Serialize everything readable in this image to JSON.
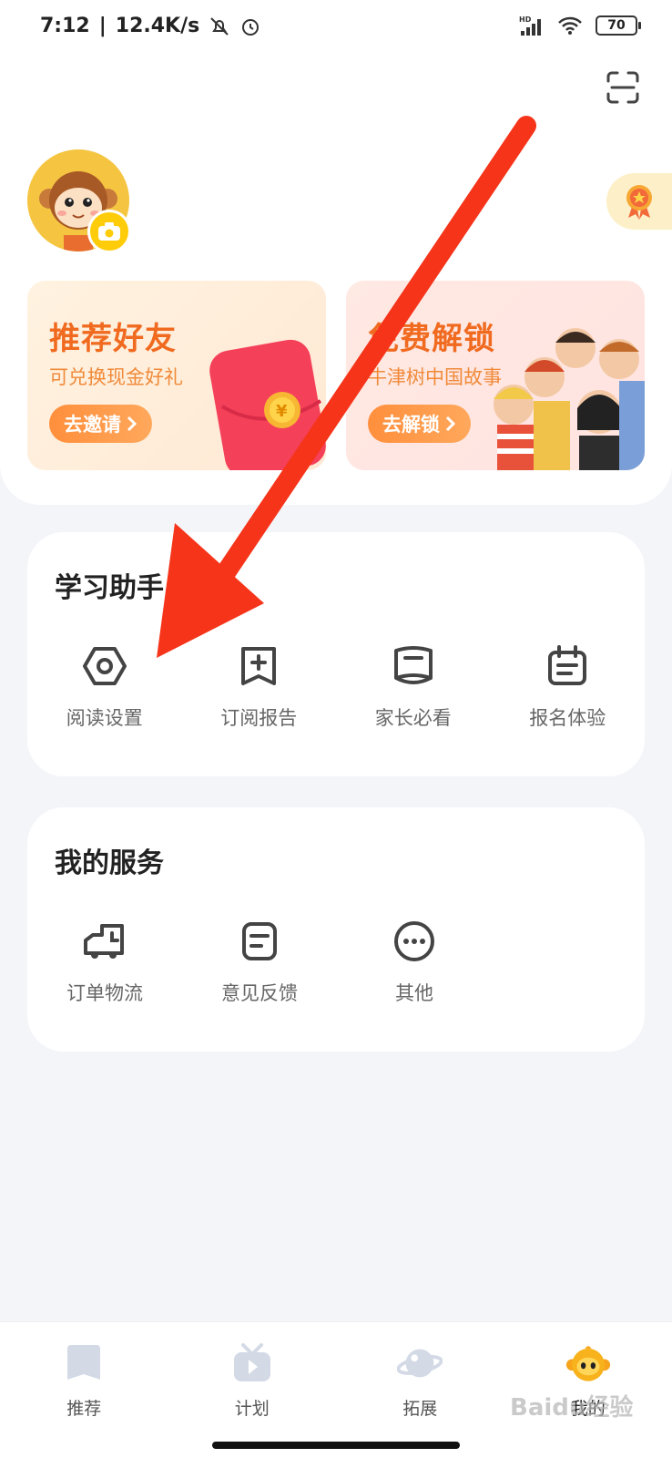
{
  "status_bar": {
    "time": "7:12",
    "speed": "12.4K/s",
    "network": "HD",
    "battery": "70"
  },
  "profile": {
    "avatar_icon": "monkey-avatar",
    "camera_icon": "camera-icon",
    "medal_icon": "medal-icon",
    "scan_icon": "scan-icon"
  },
  "promos": [
    {
      "title": "推荐好友",
      "subtitle": "可兑换现金好礼",
      "button": "去邀请",
      "accent": "#f06a1f"
    },
    {
      "title": "免费解锁",
      "subtitle": "牛津树中国故事",
      "button": "去解锁",
      "accent": "#f06a1f"
    }
  ],
  "study": {
    "title": "学习助手",
    "items": [
      {
        "label": "阅读设置",
        "icon": "hexagon-settings-icon"
      },
      {
        "label": "订阅报告",
        "icon": "add-bookmark-icon"
      },
      {
        "label": "家长必看",
        "icon": "book-icon"
      },
      {
        "label": "报名体验",
        "icon": "calendar-icon"
      }
    ]
  },
  "services": {
    "title": "我的服务",
    "items": [
      {
        "label": "订单物流",
        "icon": "delivery-truck-icon"
      },
      {
        "label": "意见反馈",
        "icon": "feedback-icon"
      },
      {
        "label": "其他",
        "icon": "more-icon"
      }
    ]
  },
  "tabs": [
    {
      "label": "推荐",
      "icon": "recommend-icon",
      "active": false
    },
    {
      "label": "计划",
      "icon": "plan-icon",
      "active": false
    },
    {
      "label": "拓展",
      "icon": "planet-icon",
      "active": false
    },
    {
      "label": "我的",
      "icon": "mine-monkey-icon",
      "active": true
    }
  ],
  "watermark": "Baidu经验",
  "colors": {
    "accent": "#f06a1f",
    "arrow": "#f5341a",
    "avatar_bg": "#f5c542"
  }
}
